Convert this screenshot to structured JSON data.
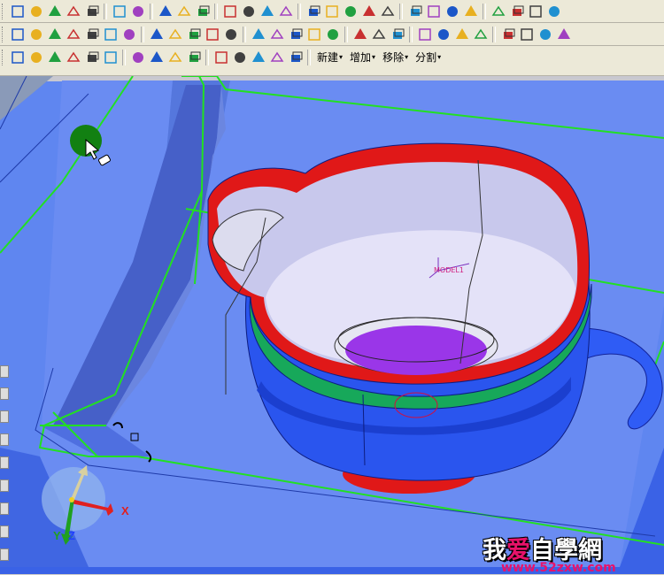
{
  "toolbar1": {
    "icons": [
      "glasses-icon",
      "zoom-window-icon",
      "zoom-in-icon",
      "zoom-out-icon",
      "pan-icon",
      "wireframe-box-icon",
      "shaded-box-icon",
      "layers-icon",
      "fill-color-icon",
      "paint-brush-icon",
      "view-front-icon",
      "view-top-icon",
      "view-side-icon",
      "view-iso-icon",
      "spotlight-icon",
      "light-bulb-icon",
      "light-bulb-yellow-icon",
      "arrow-left-icon",
      "arrow-right-icon",
      "solid-cube-icon",
      "cube-outline-icon",
      "cube-dashed-icon",
      "cube-corner-icon",
      "line-tool-icon",
      "point-icon",
      "target-icon",
      "ruler-icon"
    ]
  },
  "toolbar2": {
    "icons": [
      "sketch-icon",
      "extrude-icon",
      "revolve-icon",
      "sweep-icon",
      "loft-icon",
      "rib-icon",
      "shell-icon",
      "draft-icon",
      "fillet-icon",
      "chamfer-icon",
      "hole-icon",
      "pattern-icon",
      "mirror-icon",
      "merge-icon",
      "trim-icon",
      "intersect-icon",
      "surface-icon",
      "offset-icon",
      "thicken-icon",
      "split-face-icon",
      "copy-icon",
      "paste-icon",
      "solidify-icon",
      "replace-icon",
      "move-face-icon",
      "delete-face-icon",
      "bolt-icon",
      "gear-icon"
    ]
  },
  "toolbar3": {
    "icons": [
      "filter-icon",
      "filter-add-icon",
      "filter-remove-icon",
      "filter-edge-icon",
      "filter-face-icon",
      "filter-body-icon",
      "selection-list-icon",
      "table-icon",
      "report-icon",
      "grid-icon",
      "circle-tool-icon",
      "square-tool-icon",
      "polygon-icon",
      "fill-region-icon",
      "tangent-icon"
    ],
    "menus": [
      {
        "label": "新建"
      },
      {
        "label": "增加"
      },
      {
        "label": "移除"
      },
      {
        "label": "分割"
      }
    ]
  },
  "viewport": {
    "model_label": "MODEL1",
    "axis_x": "X",
    "axis_y": "Y",
    "axis_z": "Z"
  },
  "watermark": {
    "chars_left": "我",
    "chars_mid": "爱",
    "chars_right": "自學網",
    "url": "www.52zxw.com"
  },
  "colors": {
    "background": "#5f86f0",
    "plate_top": "#4a6fe0",
    "cup_body": "#2f5cf5",
    "rim_red": "#e01818",
    "rim_green": "#17a85a",
    "inner_purple": "#9a36e8",
    "edge_green": "#28e028"
  }
}
